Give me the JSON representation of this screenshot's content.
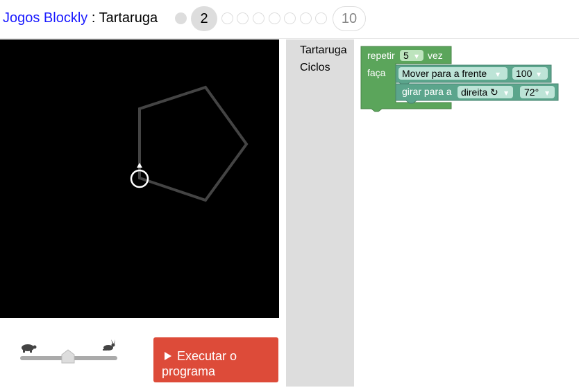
{
  "header": {
    "app_title": "Jogos Blockly",
    "separator": " : ",
    "game_title": "Tartaruga",
    "current_level": "2",
    "last_level": "10"
  },
  "controls": {
    "run_label_line1": "Executar o",
    "run_label_line2": "programa"
  },
  "toolbox": {
    "categories": [
      "Tartaruga",
      "Ciclos"
    ]
  },
  "blocks": {
    "repeat_label": "repetir",
    "repeat_count": "5",
    "repeat_suffix": "vez",
    "do_label": "faça",
    "move_label": "Mover para a frente",
    "move_value": "100",
    "turn_label": "girar para a",
    "turn_direction": "direita ↻",
    "turn_value": "72°"
  },
  "colors": {
    "loop_block": "#5ba55b",
    "turtle_block": "#5ba58c",
    "run_button": "#dd4b39",
    "title_link": "#1a1aff",
    "toolbox_bg": "#dddddd"
  }
}
